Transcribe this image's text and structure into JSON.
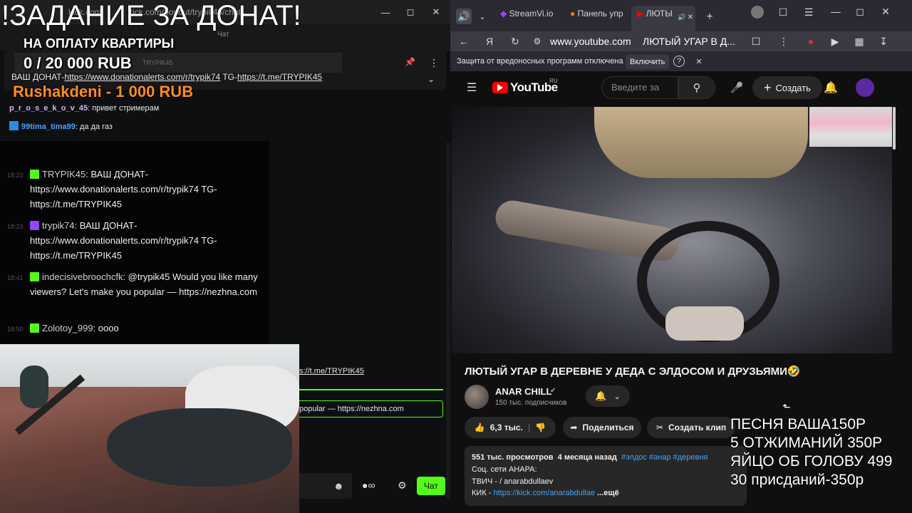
{
  "left_window": {
    "title_fragment_1": "kick.com",
    "title_fragment_2": "kick.com/popout/trypik45/chat",
    "chat_tab": "Чат",
    "pinned": {
      "text_prefix": "ВАШ ДОНАТ-",
      "link1": "https://www.donationalerts.com/r/trypik74",
      "mid": " TG-",
      "link2": "https://t.me/TRYPIK45",
      "small_user": "TRYPIK45"
    },
    "old_messages": [
      {
        "user": "p_r_o_s_e_k_o_v_45",
        "text": ": привет стримерам"
      },
      {
        "user": "99tima_tima99",
        "text": ": да да газ"
      }
    ],
    "messages": [
      {
        "time": "18:23",
        "user": "TRYPIK45",
        "text": ": ВАШ ДОНАТ-https://www.donationalerts.com/r/trypik74 TG-https://t.me/TRYPIK45",
        "platform": "kick"
      },
      {
        "time": "18:23",
        "user": "trypik74",
        "text": ": ВАШ ДОНАТ-https://www.donationalerts.com/r/trypik74 TG-https://t.me/TRYPIK45",
        "platform": "twitch"
      },
      {
        "time": "18:41",
        "user": "indecisivebroochcfk",
        "text": ": @trypik45 Would you like many viewers? Let's make you popular — https://nezhna.com",
        "platform": "kick"
      },
      {
        "time": "18:50",
        "user": "Zolotoy_999",
        "text": ": oooo",
        "platform": "kick"
      }
    ],
    "link_line": "s://t.me/TRYPIK45",
    "reply_text": "popular — https://nezhna.com",
    "send_label": "Чат",
    "points_symbol": "∞"
  },
  "overlay": {
    "donation_title": "!ЗАДАНИЕ ЗА ДОНАТ!",
    "donation_sub": "НА ОПЛАТУ КВАРТИРЫ",
    "donation_count": "0 / 20 000 RUB",
    "donation_progress": 0.0,
    "top_donor": "Rushakdeni - 1 000 RUB",
    "price_list": [
      "ПЕСНЯ ВАША150Р",
      "5 ОТЖИМАНИЙ 350Р",
      "ЯЙЦО ОБ ГОЛОВУ 499",
      "30 присданий-350р"
    ]
  },
  "browser": {
    "tabs": [
      {
        "label": "StreamVi.io"
      },
      {
        "label": "Панель упр"
      },
      {
        "label": "ЛЮТЫ"
      }
    ],
    "url": "www.youtube.com",
    "page_title": "ЛЮТЫЙ УГАР В Д...",
    "warning_text": "Защита от вредоносных программ отключена",
    "warning_enable": "Включить"
  },
  "youtube": {
    "logo_text": "YouTube",
    "logo_region": "RU",
    "search_placeholder": "Введите за",
    "create_label": "Создать",
    "video_title": "ЛЮТЫЙ УГАР В ДЕРЕВНЕ У ДЕДА С ЭЛДОСОМ И ДРУЗЬЯМИ🤣",
    "channel_name": "ANAR CHILL",
    "channel_subs": "150 тыс. подписчиков",
    "likes": "6,3 тыс.",
    "share_label": "Поделиться",
    "clip_label": "Создать клип",
    "views": "551 тыс. просмотров",
    "ago": "4 месяца назад",
    "tags": "#элдос #анар #деревня",
    "desc_line1": "Соц. сети АНАРА:",
    "desc_line2": "ТВИЧ -   / anarabdullaev",
    "desc_line3_prefix": "КИК - ",
    "desc_line3_link": "https://kick.com/anarabdullae",
    "desc_more": "...ещё"
  },
  "colors": {
    "kick_green": "#53fc18",
    "donor_orange": "#ff8c22",
    "yt_red": "#ff0000",
    "link_blue": "#3ea6ff"
  }
}
